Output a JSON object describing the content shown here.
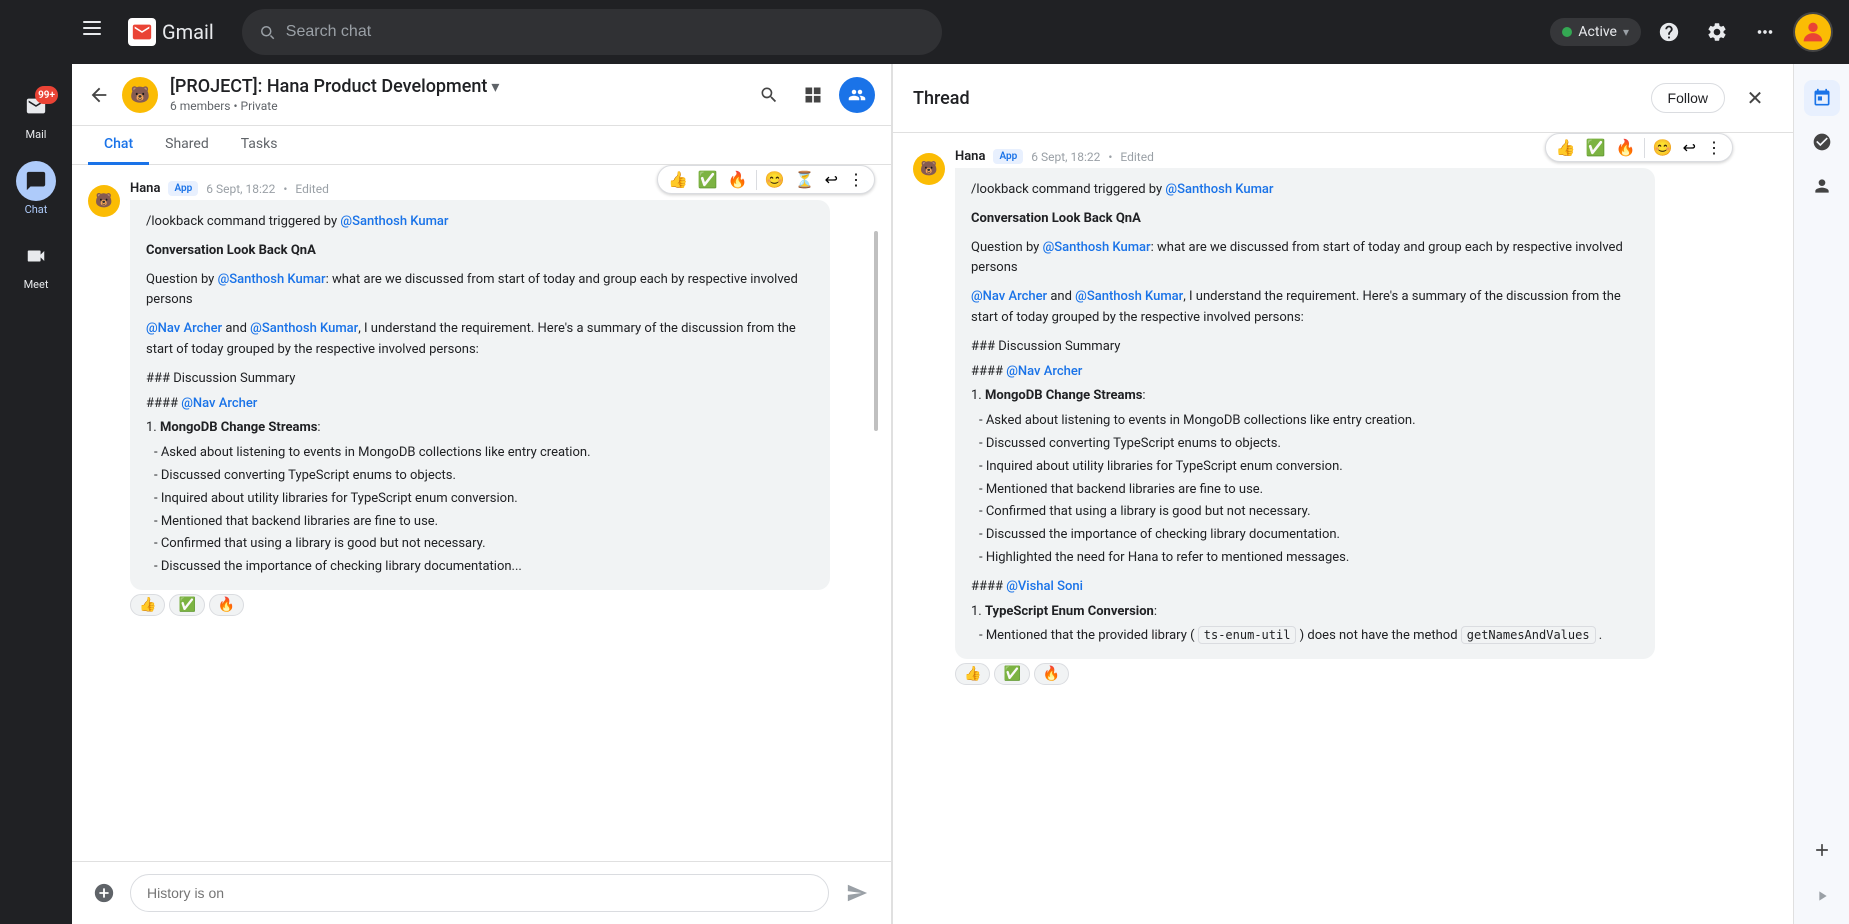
{
  "topbar": {
    "search_placeholder": "Search chat",
    "active_label": "Active",
    "hamburger_label": "Main menu"
  },
  "gmail": {
    "logo_text": "Gmail"
  },
  "sidebar": {
    "items": [
      {
        "id": "mail",
        "label": "Mail",
        "badge": "99+"
      },
      {
        "id": "chat",
        "label": "Chat",
        "active": true
      },
      {
        "id": "meet",
        "label": "Meet"
      }
    ]
  },
  "chat_header": {
    "title": "[PROJECT]: Hana Product Development",
    "subtitle": "6 members • Private",
    "has_dropdown": true
  },
  "chat_tabs": [
    {
      "id": "chat",
      "label": "Chat",
      "active": true
    },
    {
      "id": "shared",
      "label": "Shared"
    },
    {
      "id": "tasks",
      "label": "Tasks"
    }
  ],
  "message": {
    "sender": "Hana",
    "app_badge": "App",
    "time": "6 Sept, 18:22",
    "edited": "Edited",
    "reactions": [
      "👍",
      "✅",
      "🔥"
    ],
    "command_line": "/lookback command triggered by @Santhosh Kumar",
    "mention_santhosh": "@Santhosh Kumar",
    "mention_nav": "@Nav Archer",
    "conversation_header": "Conversation Look Back QnA",
    "question_prefix": "Question by",
    "question_text": ": what are we discussed from start of today and group each by respective involved persons",
    "response_intro": ", I understand the requirement. Here's a summary of the discussion from the start of today grouped by the respective involved persons:",
    "discussion_summary_header": "### Discussion Summary",
    "nav_archer_header": "#### @Nav Archer",
    "mongodb_header": "MongoDB Change Streams",
    "mongodb_colon": ":",
    "mongodb_item1": "   - Asked about listening to events in MongoDB collections like entry creation.",
    "mongodb_item2": "   - Discussed converting TypeScript enums to objects.",
    "mongodb_item3": "   - Inquired about utility libraries for TypeScript enum conversion.",
    "mongodb_item4": "   - Mentioned that backend libraries are fine to use.",
    "mongodb_item5": "   - Confirmed that using a library is good but not necessary.",
    "mongodb_item6": "   - Discussed the importance of checking library documentation..."
  },
  "chat_input": {
    "placeholder": "History is on",
    "send_label": "Send"
  },
  "thread": {
    "title": "Thread",
    "follow_label": "Follow",
    "close_label": "×",
    "sender": "Hana",
    "app_badge": "App",
    "time": "6 Sept, 18:22",
    "edited": "Edited",
    "reactions": [
      "👍",
      "✅",
      "🔥"
    ],
    "command_line": "/lookback command triggered by @Santhosh Kumar",
    "mention_santhosh": "@Santhosh Kumar",
    "mention_nav": "@Nav Archer",
    "mention_nav2": "@Nav Archer",
    "mention_santhosh2": "@Santhosh Kumar",
    "conversation_header": "Conversation Look Back QnA",
    "question_prefix": "Question by",
    "question_text": ": what are we discussed from start of today and group each by respective involved persons",
    "response_intro": ", I understand the requirement. Here's a summary of the discussion from the start of today grouped by the respective involved persons:",
    "discussion_summary_header": "### Discussion Summary",
    "nav_archer_header": "#### @Nav Archer",
    "mongodb_header": "MongoDB Change Streams",
    "mongodb_item1": "- Asked about listening to events in MongoDB collections like entry creation.",
    "mongodb_item2": "- Discussed converting TypeScript enums to objects.",
    "mongodb_item3": "- Inquired about utility libraries for TypeScript enum conversion.",
    "mongodb_item4": "- Mentioned that backend libraries are fine to use.",
    "mongodb_item5": "- Confirmed that using a library is good but not necessary.",
    "mongodb_item6": "- Discussed the importance of checking library documentation.",
    "mongodb_item7": "- Highlighted the need for Hana to refer to mentioned messages.",
    "vishal_header": "#### @Vishal Soni",
    "ts_header": "TypeScript Enum Conversion",
    "ts_item1_prefix": "- Mentioned that the provided library (",
    "ts_item1_code": "ts-enum-util",
    "ts_item1_suffix": ") does not have the method",
    "ts_item2_code": "getNamesAndValues",
    "ts_item2_suffix": "."
  }
}
